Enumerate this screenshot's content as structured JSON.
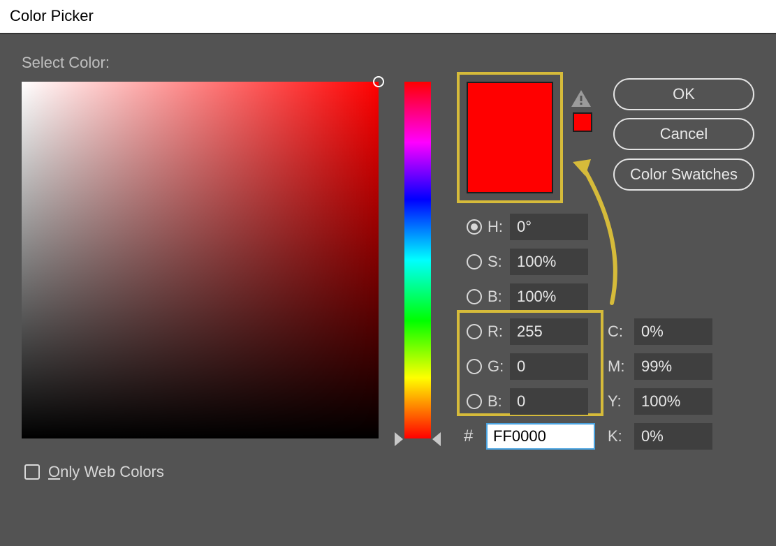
{
  "window": {
    "title": "Color Picker"
  },
  "labels": {
    "select": "Select Color:",
    "only_web": "Only Web Colors",
    "hash": "#"
  },
  "buttons": {
    "ok": "OK",
    "cancel": "Cancel",
    "swatches": "Color Swatches"
  },
  "hsb": {
    "h_label": "H:",
    "h_value": "0°",
    "s_label": "S:",
    "s_value": "100%",
    "b_label": "B:",
    "b_value": "100%"
  },
  "rgb": {
    "r_label": "R:",
    "r_value": "255",
    "g_label": "G:",
    "g_value": "0",
    "b_label": "B:",
    "b_value": "0"
  },
  "cmyk": {
    "c_label": "C:",
    "c_value": "0%",
    "m_label": "M:",
    "m_value": "99%",
    "y_label": "Y:",
    "y_value": "100%",
    "k_label": "K:",
    "k_value": "0%"
  },
  "hex": {
    "value": "FF0000"
  },
  "colors": {
    "selected": "#ff0000",
    "previous": "#ff0000",
    "highlight": "#d6bb3a"
  }
}
